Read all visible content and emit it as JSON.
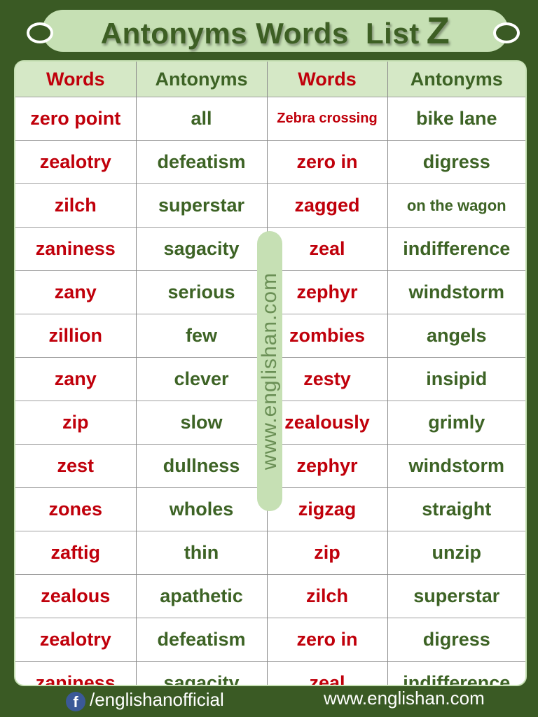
{
  "title": {
    "text": "Antonyms Words  List",
    "letter": "Z"
  },
  "headers": [
    "Words",
    "Antonyms",
    "Words",
    "Antonyms"
  ],
  "rows": [
    [
      "zero point",
      "all",
      "Zebra crossing",
      "bike lane"
    ],
    [
      "zealotry",
      "defeatism",
      "zero in",
      "digress"
    ],
    [
      "zilch",
      "superstar",
      "zagged",
      "on the wagon"
    ],
    [
      "zaniness",
      "sagacity",
      "zeal",
      "indifference"
    ],
    [
      "zany",
      "serious",
      "zephyr",
      "windstorm"
    ],
    [
      "zillion",
      "few",
      "zombies",
      "angels"
    ],
    [
      "zany",
      "clever",
      "zesty",
      "insipid"
    ],
    [
      "zip",
      "slow",
      "zealously",
      "grimly"
    ],
    [
      "zest",
      "dullness",
      "zephyr",
      "windstorm"
    ],
    [
      "zones",
      "wholes",
      "zigzag",
      "straight"
    ],
    [
      "zaftig",
      "thin",
      "zip",
      "unzip"
    ],
    [
      "zealous",
      "apathetic",
      "zilch",
      "superstar"
    ],
    [
      "zealotry",
      "defeatism",
      "zero in",
      "digress"
    ],
    [
      "zaniness",
      "sagacity",
      "zeal",
      "indifference"
    ]
  ],
  "watermark": "www.englishan.com",
  "footer": {
    "facebook_icon": "facebook-icon",
    "facebook_glyph": "f",
    "facebook_handle": "/englishanofficial",
    "website": "www.englishan.com"
  },
  "colors": {
    "background": "#3a5a24",
    "banner": "#c6e0b4",
    "word": "#c0000b",
    "antonym": "#3d6325"
  }
}
